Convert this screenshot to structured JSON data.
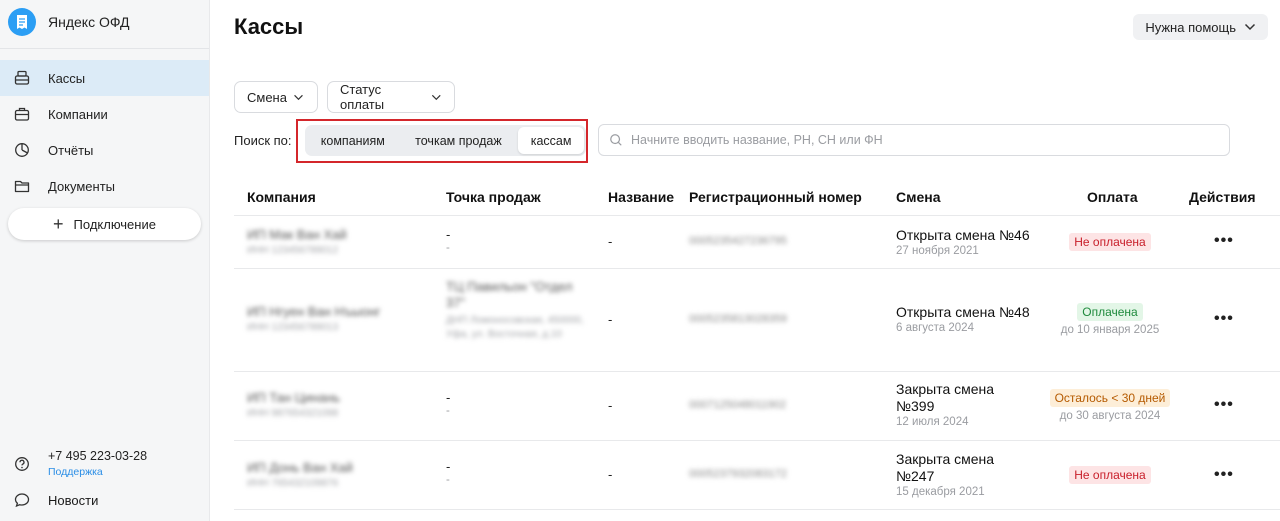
{
  "brand": {
    "name": "Яндекс ОФД"
  },
  "sidebar": {
    "items": [
      {
        "label": "Кассы",
        "icon": "cash-register-icon",
        "active": true
      },
      {
        "label": "Компании",
        "icon": "briefcase-icon"
      },
      {
        "label": "Отчёты",
        "icon": "chart-icon"
      },
      {
        "label": "Документы",
        "icon": "folder-icon"
      }
    ],
    "connect_label": "Подключение",
    "phone": "+7 495 223-03-28",
    "support_label": "Поддержка",
    "news_label": "Новости"
  },
  "header": {
    "title": "Кассы",
    "help_label": "Нужна помощь"
  },
  "filters": {
    "shift_label": "Смена",
    "payment_label": "Статус оплаты"
  },
  "search": {
    "label": "Поиск по:",
    "options": [
      "компаниям",
      "точкам продаж",
      "кассам"
    ],
    "selected": "кассам",
    "placeholder": "Начните вводить название, РН, СН или ФН",
    "value": ""
  },
  "table": {
    "columns": [
      "Компания",
      "Точка продаж",
      "Название",
      "Регистрационный номер",
      "Смена",
      "Оплата",
      "Действия"
    ],
    "rows": [
      {
        "company": "ИП Мак Ван Хай",
        "company_sub": "ИНН 123456789012",
        "point": "-",
        "point_sub": "-",
        "name": "-",
        "reg": "0005235427236795",
        "shift": "Открыта смена №46",
        "shift_date": "27 ноября 2021",
        "payment": "Не оплачена",
        "payment_type": "red",
        "payment_sub": ""
      },
      {
        "company": "ИП Нгуен Ван Нъыонг",
        "company_sub": "ИНН 123456789013",
        "point": "ТЦ Павильон \"Отдел 37\"",
        "point_sub": "ДНП Ломоносовская, 450000, Уфа, ул. Восточная, д.10",
        "name": "-",
        "reg": "0005235813028359",
        "shift": "Открыта смена №48",
        "shift_date": "6 августа 2024",
        "payment": "Оплачена",
        "payment_type": "green",
        "payment_sub": "до 10 января 2025"
      },
      {
        "company": "ИП Тан Цинань",
        "company_sub": "ИНН 987654321098",
        "point": "-",
        "point_sub": "-",
        "name": "-",
        "reg": "0007125048011902",
        "shift": "Закрыта смена №399",
        "shift_date": "12 июля 2024",
        "payment": "Осталось < 30 дней",
        "payment_type": "orange",
        "payment_sub": "до 30 августа 2024"
      },
      {
        "company": "ИП Донь Ван Хай",
        "company_sub": "ИНН 765432109876",
        "point": "-",
        "point_sub": "-",
        "name": "-",
        "reg": "0005237932083172",
        "shift": "Закрыта смена №247",
        "shift_date": "15 декабря 2021",
        "payment": "Не оплачена",
        "payment_type": "red",
        "payment_sub": ""
      }
    ],
    "actions_label": "•••"
  }
}
